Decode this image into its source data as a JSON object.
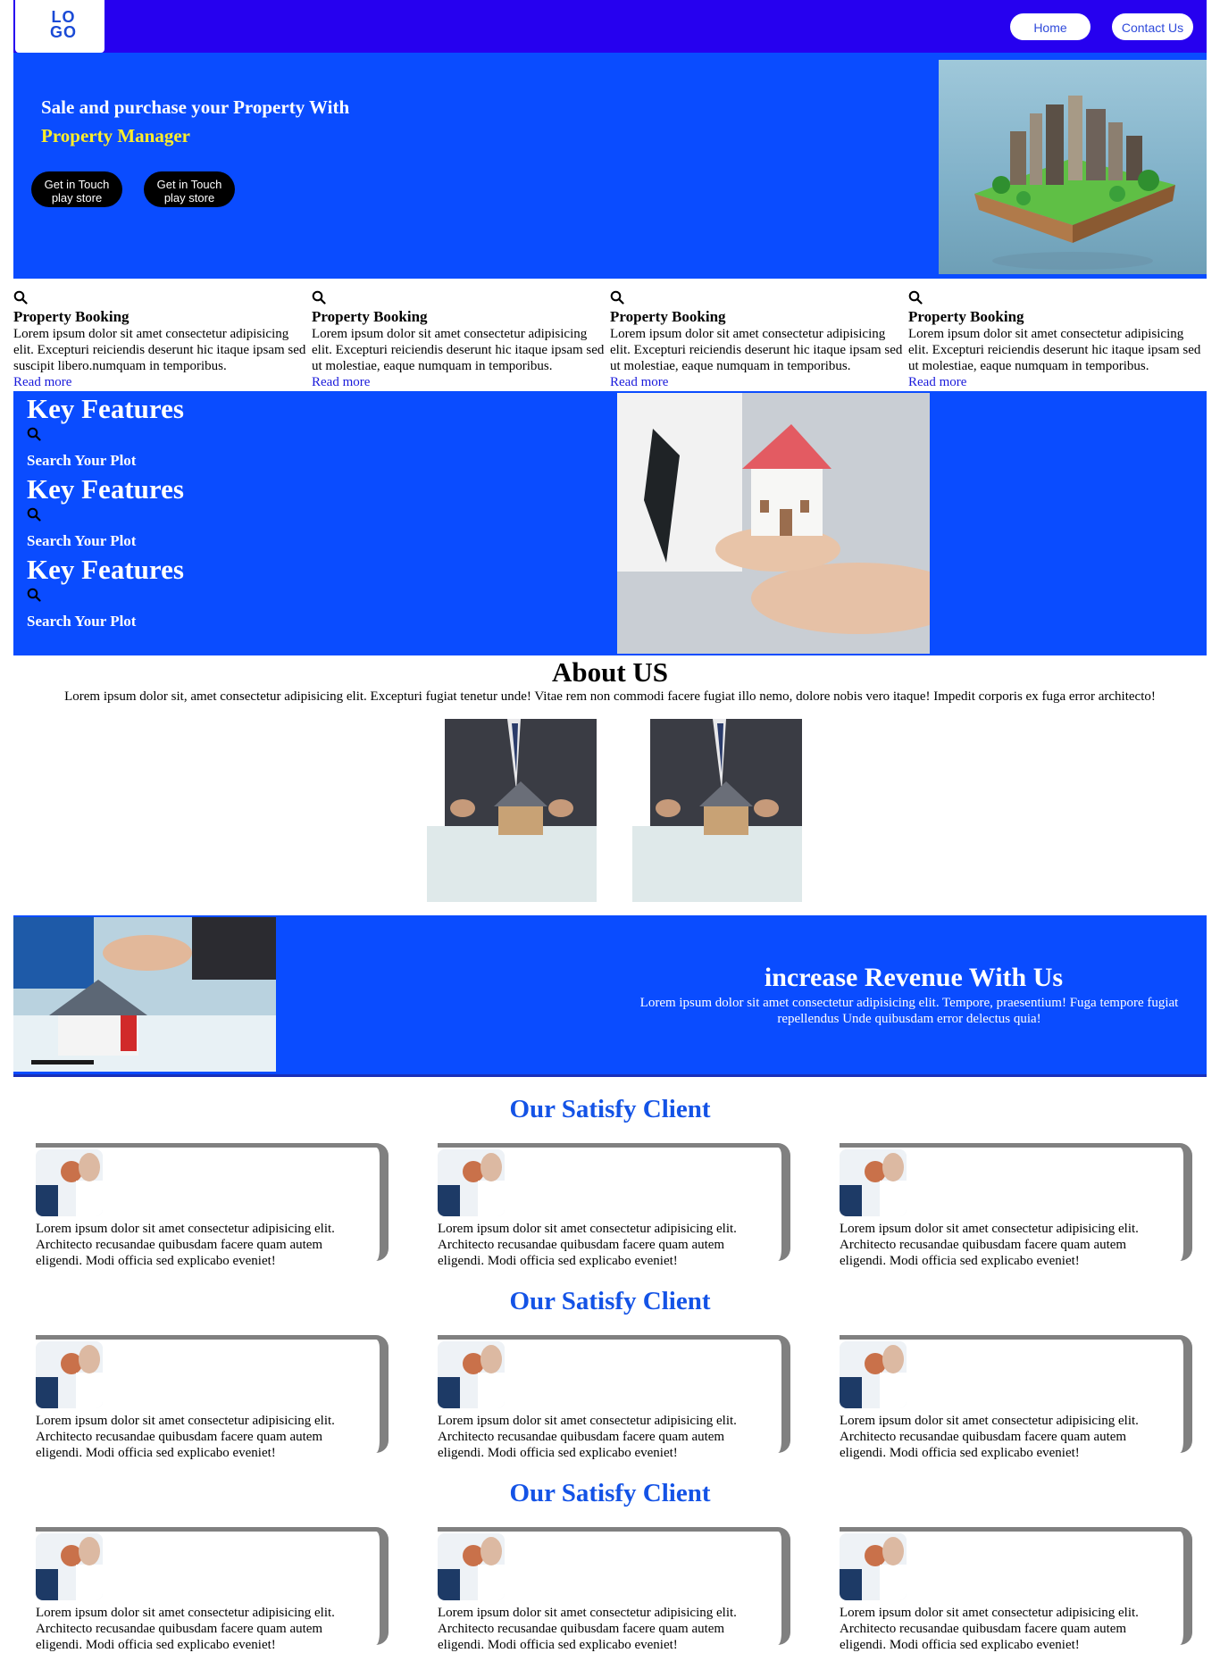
{
  "nav": {
    "logo": "LO GO",
    "links": [
      "Home",
      "Contact Us"
    ]
  },
  "hero": {
    "title_line1": "Sale and purchase your Property With",
    "title_line2": "Property Manager",
    "buttons": [
      {
        "line1": "Get in Touch",
        "line2": "play store"
      },
      {
        "line1": "Get in Touch",
        "line2": "play store"
      }
    ]
  },
  "features": [
    {
      "icon": "search-icon",
      "title": "Property Booking",
      "text": "Lorem ipsum dolor sit amet consectetur adipisicing elit. Excepturi reiciendis deserunt hic itaque ipsam sed suscipit libero.numquam in temporibus.",
      "link": "Read more"
    },
    {
      "icon": "search-icon",
      "title": "Property Booking",
      "text": "Lorem ipsum dolor sit amet consectetur adipisicing elit. Excepturi reiciendis deserunt hic itaque ipsam sed ut molestiae, eaque numquam in temporibus.",
      "link": "Read more"
    },
    {
      "icon": "search-icon",
      "title": "Property Booking",
      "text": "Lorem ipsum dolor sit amet consectetur adipisicing elit. Excepturi reiciendis deserunt hic itaque ipsam sed ut molestiae, eaque numquam in temporibus.",
      "link": "Read more"
    },
    {
      "icon": "search-icon",
      "title": "Property Booking",
      "text": "Lorem ipsum dolor sit amet consectetur adipisicing elit. Excepturi reiciendis deserunt hic itaque ipsam sed ut molestiae, eaque numquam in temporibus.",
      "link": "Read more"
    }
  ],
  "key_features": [
    {
      "title": "Key Features",
      "icon": "search-icon",
      "subtitle": "Search Your Plot"
    },
    {
      "title": "Key Features",
      "icon": "search-icon",
      "subtitle": "Search Your Plot"
    },
    {
      "title": "Key Features",
      "icon": "search-icon",
      "subtitle": "Search Your Plot"
    }
  ],
  "about": {
    "title": "About US",
    "text": "Lorem ipsum dolor sit, amet consectetur adipisicing elit. Excepturi fugiat tenetur unde! Vitae rem non commodi facere fugiat illo nemo, dolore nobis vero itaque! Impedit corporis ex fuga error architecto!"
  },
  "revenue": {
    "title": "increase Revenue With Us",
    "text": "Lorem ipsum dolor sit amet consectetur adipisicing elit. Tempore, praesentium! Fuga tempore fugiat repellendus Unde quibusdam error delectus quia!"
  },
  "clients": {
    "sections": [
      {
        "title": "Our Satisfy Client",
        "cards": [
          {
            "text": "Lorem ipsum dolor sit amet consectetur adipisicing elit. Architecto recusandae quibusdam facere quam autem eligendi. Modi officia sed explicabo eveniet!"
          },
          {
            "text": "Lorem ipsum dolor sit amet consectetur adipisicing elit. Architecto recusandae quibusdam facere quam autem eligendi. Modi officia sed explicabo eveniet!"
          },
          {
            "text": "Lorem ipsum dolor sit amet consectetur adipisicing elit. Architecto recusandae quibusdam facere quam autem eligendi. Modi officia sed explicabo eveniet!"
          }
        ]
      },
      {
        "title": "Our Satisfy Client",
        "cards": [
          {
            "text": "Lorem ipsum dolor sit amet consectetur adipisicing elit. Architecto recusandae quibusdam facere quam autem eligendi. Modi officia sed explicabo eveniet!"
          },
          {
            "text": "Lorem ipsum dolor sit amet consectetur adipisicing elit. Architecto recusandae quibusdam facere quam autem eligendi. Modi officia sed explicabo eveniet!"
          },
          {
            "text": "Lorem ipsum dolor sit amet consectetur adipisicing elit. Architecto recusandae quibusdam facere quam autem eligendi. Modi officia sed explicabo eveniet!"
          }
        ]
      },
      {
        "title": "Our Satisfy Client",
        "cards": [
          {
            "text": "Lorem ipsum dolor sit amet consectetur adipisicing elit. Architecto recusandae quibusdam facere quam autem eligendi. Modi officia sed explicabo eveniet!"
          },
          {
            "text": "Lorem ipsum dolor sit amet consectetur adipisicing elit. Architecto recusandae quibusdam facere quam autem eligendi. Modi officia sed explicabo eveniet!"
          },
          {
            "text": "Lorem ipsum dolor sit amet consectetur adipisicing elit. Architecto recusandae quibusdam facere quam autem eligendi. Modi officia sed explicabo eveniet!"
          }
        ]
      }
    ]
  },
  "colors": {
    "nav_bg": "#2600ef",
    "section_blue": "#0a4cff",
    "accent_yellow": "#ffee2a",
    "client_title": "#1453e6",
    "card_border": "#808080"
  }
}
